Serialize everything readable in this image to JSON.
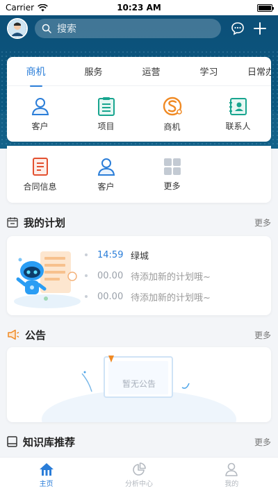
{
  "status_bar": {
    "carrier": "Carrier",
    "time": "10:23 AM"
  },
  "header": {
    "search_placeholder": "搜索"
  },
  "tabs": [
    {
      "label": "商机",
      "active": true
    },
    {
      "label": "服务"
    },
    {
      "label": "运营"
    },
    {
      "label": "学习"
    },
    {
      "label": "日常办"
    }
  ],
  "tab_grid": [
    {
      "label": "客户",
      "icon": "person-icon"
    },
    {
      "label": "项目",
      "icon": "document-list-icon"
    },
    {
      "label": "商机",
      "icon": "opportunity-s-icon"
    },
    {
      "label": "联系人",
      "icon": "contact-card-icon"
    }
  ],
  "grid2": [
    {
      "label": "合同信息",
      "icon": "contract-icon"
    },
    {
      "label": "客户",
      "icon": "person-icon"
    },
    {
      "label": "更多",
      "icon": "more-grid-icon"
    }
  ],
  "plan": {
    "title": "我的计划",
    "more": "更多",
    "items": [
      {
        "time": "14:59",
        "text": "绿城"
      },
      {
        "time": "00.00",
        "text": "待添加新的计划哦~"
      },
      {
        "time": "00.00",
        "text": "待添加新的计划哦~"
      }
    ]
  },
  "notice": {
    "title": "公告",
    "more": "更多",
    "empty": "暂无公告"
  },
  "knowledge": {
    "title": "知识库推荐",
    "more": "更多"
  },
  "tabbar": [
    {
      "label": "主页",
      "active": true
    },
    {
      "label": "分析中心"
    },
    {
      "label": "我的"
    }
  ],
  "colors": {
    "brand": "#0b577f",
    "accent": "#2a7dd8",
    "orange": "#f08a24",
    "teal": "#18a58f"
  }
}
